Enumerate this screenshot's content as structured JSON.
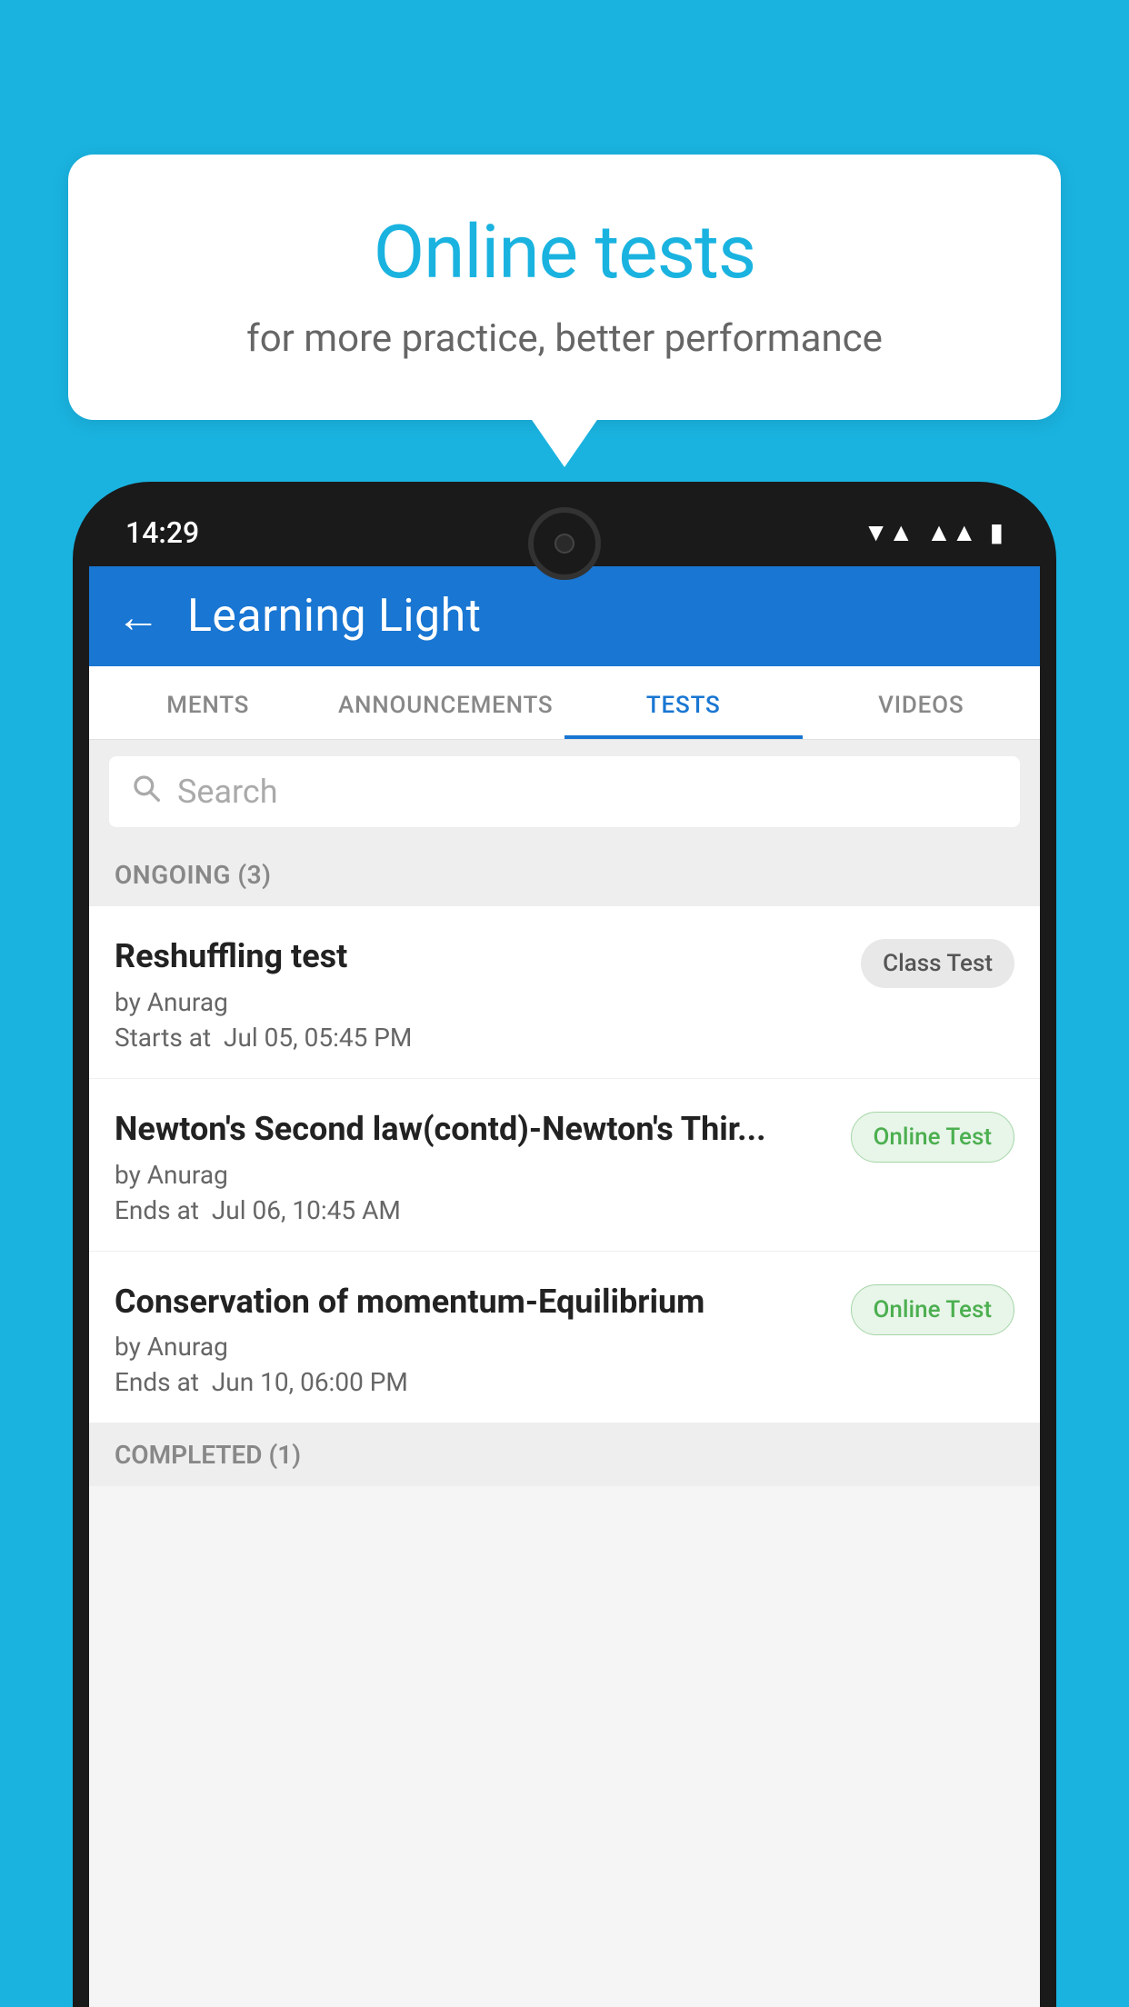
{
  "background": {
    "color": "#1ab3e0"
  },
  "speech_bubble": {
    "title": "Online tests",
    "subtitle": "for more practice, better performance"
  },
  "phone": {
    "status_bar": {
      "time": "14:29",
      "wifi_icon": "▼",
      "signal_icon": "▲",
      "battery_icon": "▮"
    },
    "app_header": {
      "back_label": "←",
      "title": "Learning Light"
    },
    "tabs": [
      {
        "label": "MENTS",
        "active": false
      },
      {
        "label": "ANNOUNCEMENTS",
        "active": false
      },
      {
        "label": "TESTS",
        "active": true
      },
      {
        "label": "VIDEOS",
        "active": false
      }
    ],
    "search": {
      "placeholder": "Search"
    },
    "sections": [
      {
        "title": "ONGOING (3)",
        "tests": [
          {
            "name": "Reshuffling test",
            "author": "by Anurag",
            "date_label": "Starts at",
            "date": "Jul 05, 05:45 PM",
            "badge": "Class Test",
            "badge_type": "class"
          },
          {
            "name": "Newton's Second law(contd)-Newton's Thir...",
            "author": "by Anurag",
            "date_label": "Ends at",
            "date": "Jul 06, 10:45 AM",
            "badge": "Online Test",
            "badge_type": "online"
          },
          {
            "name": "Conservation of momentum-Equilibrium",
            "author": "by Anurag",
            "date_label": "Ends at",
            "date": "Jun 10, 06:00 PM",
            "badge": "Online Test",
            "badge_type": "online"
          }
        ]
      }
    ],
    "completed_section": {
      "title": "COMPLETED (1)"
    }
  }
}
